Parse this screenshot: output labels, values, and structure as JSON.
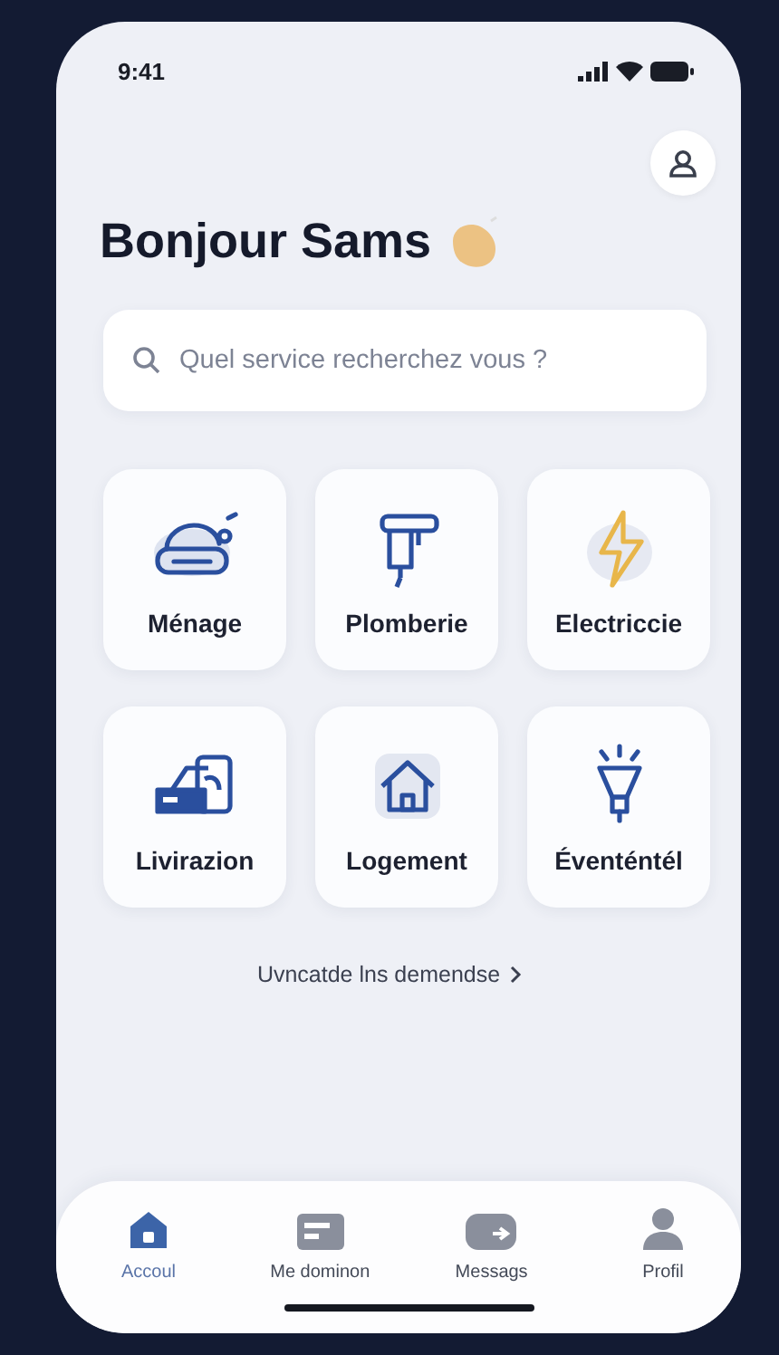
{
  "status_bar": {
    "time": "9:41"
  },
  "greeting": "Bonjour Sams",
  "search": {
    "placeholder": "Quel service recherchez vous ?"
  },
  "services": [
    {
      "label": "Ménage"
    },
    {
      "label": "Plomberie"
    },
    {
      "label": "Electriccie"
    },
    {
      "label": "Livirazion"
    },
    {
      "label": "Logement"
    },
    {
      "label": "Éventéntél"
    }
  ],
  "link": {
    "label": "Uvncatde lns demendse"
  },
  "tabs": [
    {
      "label": "Accoul",
      "selected": true
    },
    {
      "label": "Me dominon",
      "selected": false
    },
    {
      "label": "Messags",
      "selected": false
    },
    {
      "label": "Profil",
      "selected": false
    }
  ]
}
